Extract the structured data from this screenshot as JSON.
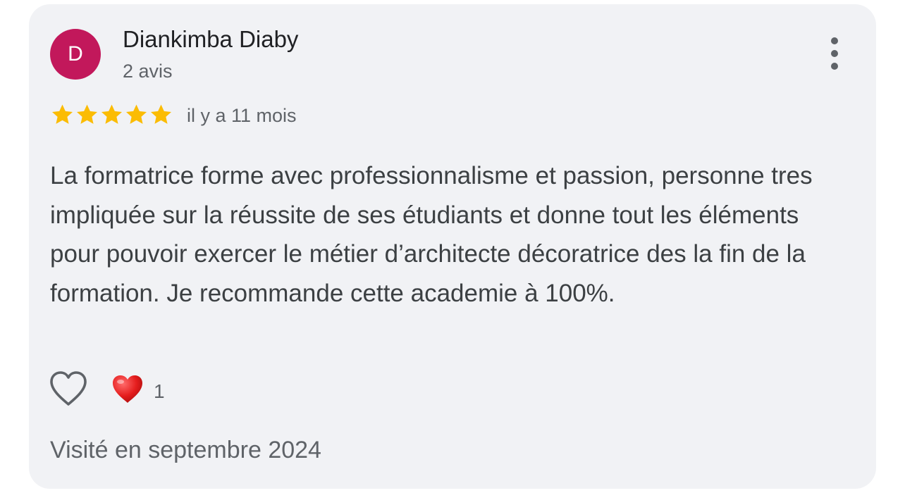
{
  "review": {
    "author": {
      "initial": "D",
      "name": "Diankimba Diaby",
      "review_count": "2 avis",
      "avatar_color": "#c2185b"
    },
    "rating": 5,
    "star_color": "#fbbc04",
    "time_ago": "il y a 11 mois",
    "text": "La formatrice forme avec professionnalisme et passion, personne tres impliquée sur la réussite de ses étudiants et donne tout les éléments pour pouvoir exercer le métier d’architecte décoratrice des la fin de la formation. Je recommande cette academie à 100%.",
    "reactions": {
      "like_icon": "heart-outline-icon",
      "reaction_icon": "red-heart-icon",
      "count": "1"
    },
    "visit": "Visité en septembre 2024"
  }
}
